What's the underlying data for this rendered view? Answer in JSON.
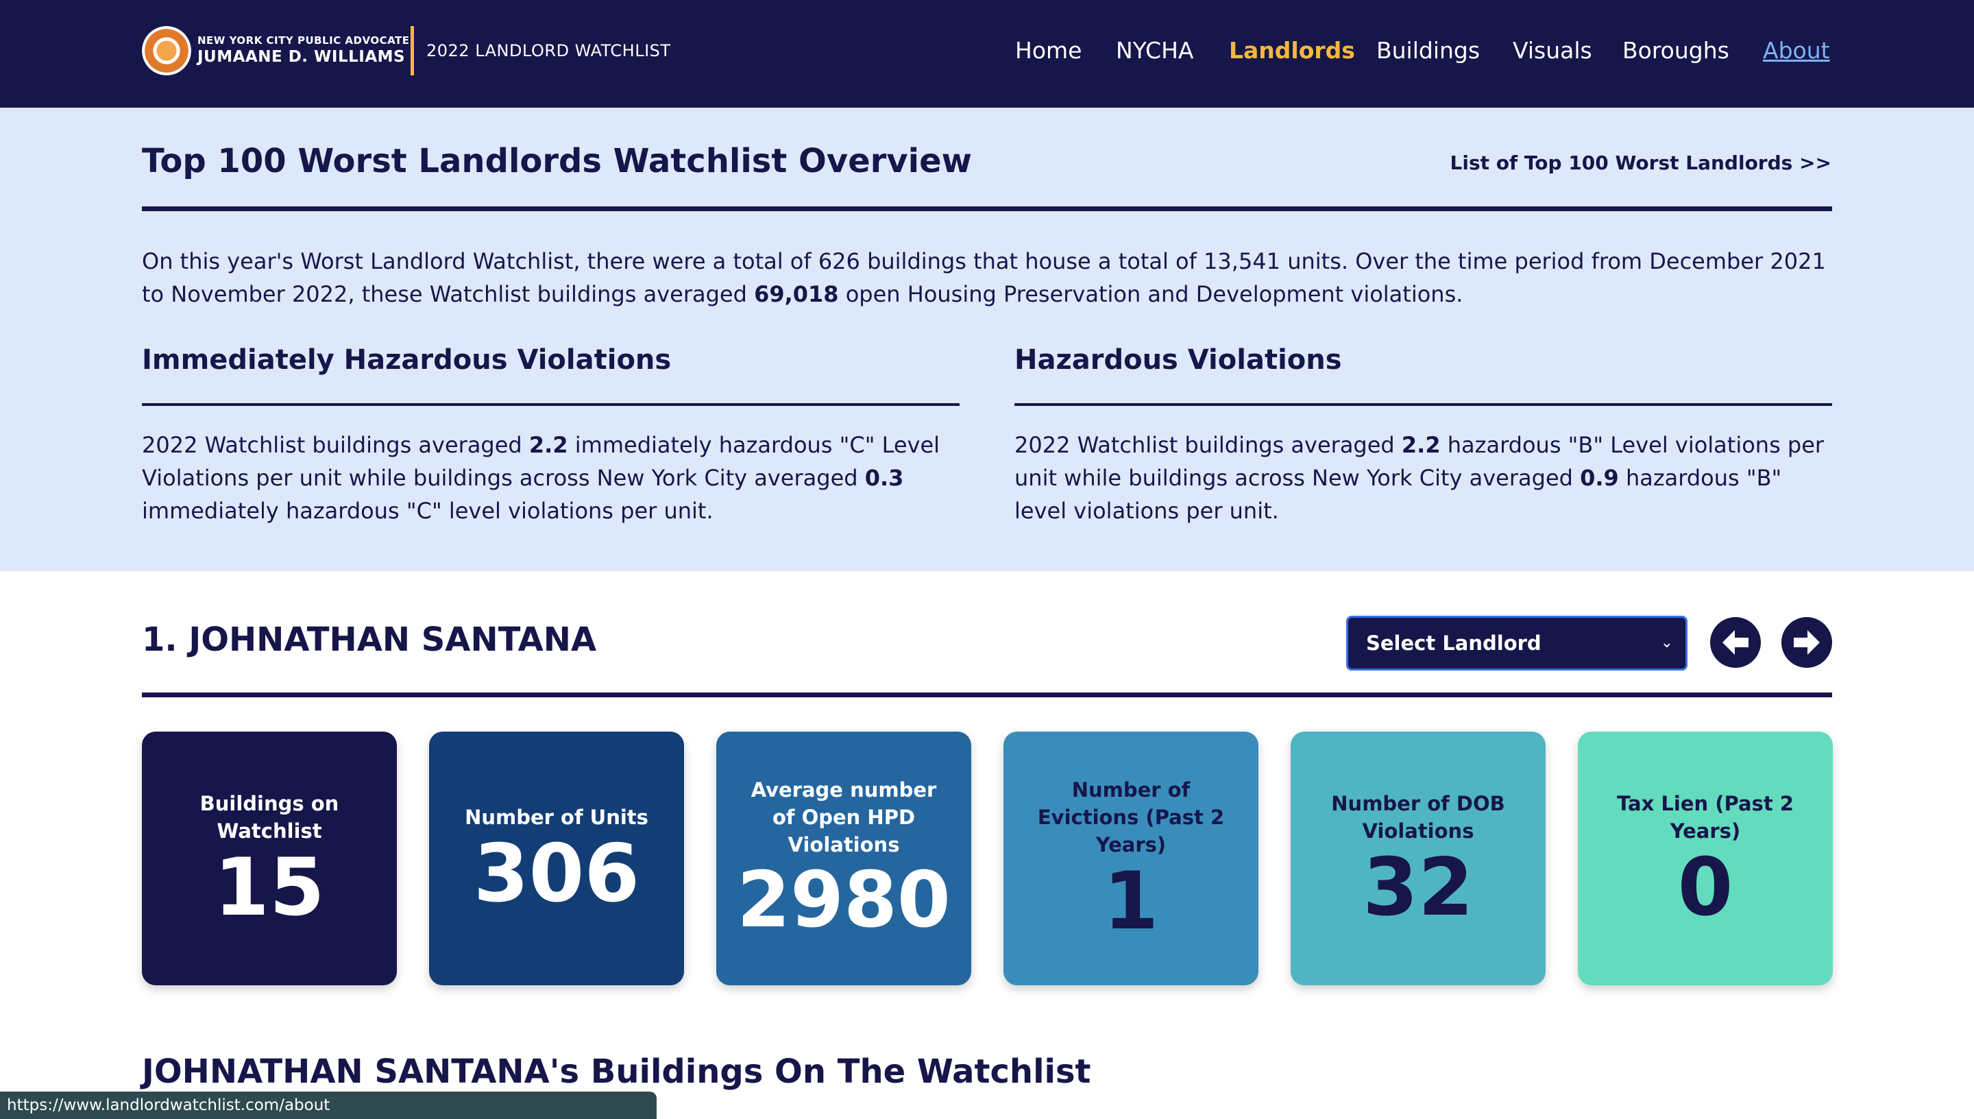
{
  "header": {
    "logo_line1": "NEW YORK CITY PUBLIC ADVOCATE",
    "logo_line2": "JUMAANE D. WILLIAMS",
    "subtitle": "2022 LANDLORD WATCHLIST",
    "colors": {
      "background": "#16164a",
      "accent": "#f5b83d",
      "link": "#7fb2f0"
    },
    "nav": [
      {
        "label": "Home",
        "state": "normal"
      },
      {
        "label": "NYCHA",
        "state": "normal"
      },
      {
        "label": "Landlords",
        "state": "active"
      },
      {
        "label": "Buildings",
        "state": "normal"
      },
      {
        "label": "Visuals",
        "state": "normal"
      },
      {
        "label": "Boroughs",
        "state": "normal"
      },
      {
        "label": "About",
        "state": "hovered-link"
      }
    ]
  },
  "overview": {
    "title": "Top 100 Worst Landlords Watchlist Overview",
    "list_link": "List of Top 100 Worst Landlords >>",
    "intro_before": "On this year's Worst Landlord Watchlist, there were a total of 626 buildings that house a total of 13,541 units. Over the time period from December 2021 to November 2022, these Watchlist buildings averaged ",
    "intro_bold": "69,018",
    "intro_after": " open Housing Preservation and Development violations.",
    "immediately_hazardous": {
      "heading": "Immediately Hazardous Violations",
      "t1": "2022 Watchlist buildings averaged ",
      "b1": "2.2",
      "t2": " immediately hazardous \"C\" Level Violations per unit while buildings across New York City averaged ",
      "b2": "0.3",
      "t3": " immediately hazardous \"C\" level violations per unit."
    },
    "hazardous": {
      "heading": "Hazardous Violations",
      "t1": "2022 Watchlist buildings averaged ",
      "b1": "2.2",
      "t2": " hazardous \"B\" Level violations per unit while buildings across New York City averaged ",
      "b2": "0.9",
      "t3": " hazardous \"B\" level violations per unit."
    }
  },
  "landlord": {
    "name": "1. JOHNATHAN SANTANA",
    "select_label": "Select Landlord",
    "prev_icon": "arrow-left-icon",
    "next_icon": "arrow-right-icon",
    "stats": [
      {
        "label": "Buildings on Watchlist",
        "value": "15",
        "bg": "#16164a",
        "fg": "#ffffff"
      },
      {
        "label": "Number of Units",
        "value": "306",
        "bg": "#133d75",
        "fg": "#ffffff"
      },
      {
        "label": "Average number of Open HPD Violations",
        "value": "2980",
        "bg": "#25669f",
        "fg": "#ffffff"
      },
      {
        "label": "Number of Evictions (Past 2 Years)",
        "value": "1",
        "bg": "#3a8dbb",
        "fg": "#16164a"
      },
      {
        "label": "Number of DOB Violations",
        "value": "32",
        "bg": "#50b5c2",
        "fg": "#16164a"
      },
      {
        "label": "Tax Lien (Past 2 Years)",
        "value": "0",
        "bg": "#62dcbd",
        "fg": "#16164a"
      }
    ],
    "buildings_title": "JOHNATHAN SANTANA's Buildings On The Watchlist"
  },
  "status_bar": {
    "url": "https://www.landlordwatchlist.com/about"
  }
}
